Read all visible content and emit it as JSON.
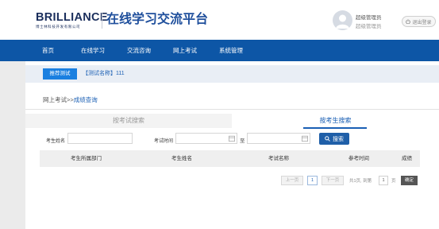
{
  "header": {
    "logo_text": "BRILLIANCE",
    "logo_subtext": "博士林科技开发有限公司",
    "site_title": "在线学习交流平台",
    "user_role": "超级管理员",
    "user_name": "超级管理员",
    "logout_label": "退出登录"
  },
  "nav": {
    "items": [
      {
        "label": "首页"
      },
      {
        "label": "在线学习"
      },
      {
        "label": "交流咨询"
      },
      {
        "label": "网上考试"
      },
      {
        "label": "系统管理"
      }
    ]
  },
  "recommend": {
    "button_label": "推荐测试",
    "text": "【测试名称】111"
  },
  "breadcrumb": {
    "parent": "网上考试",
    "separator": ">>",
    "current": "成绩查询"
  },
  "tabs": [
    {
      "label": "按考试搜索",
      "active": false
    },
    {
      "label": "按考生搜索",
      "active": true
    }
  ],
  "filters": {
    "name_label": "考生姓名",
    "name_value": "",
    "time_label": "考试时间",
    "time_start": "",
    "time_end": "",
    "to_label": "至",
    "search_button": "搜索"
  },
  "table": {
    "columns": [
      "考生所属部门",
      "考生姓名",
      "考试名称",
      "参考时间",
      "成绩"
    ],
    "rows": []
  },
  "pagination": {
    "prev_label": "上一页",
    "current_page": "1",
    "next_label": "下一页",
    "summary": "共1页, 到第",
    "page_input": "1",
    "page_unit": "页",
    "go_label": "确定"
  },
  "colors": {
    "nav_bg": "#0d56a6",
    "accent": "#1a7fe0",
    "link": "#1a5fb4"
  }
}
